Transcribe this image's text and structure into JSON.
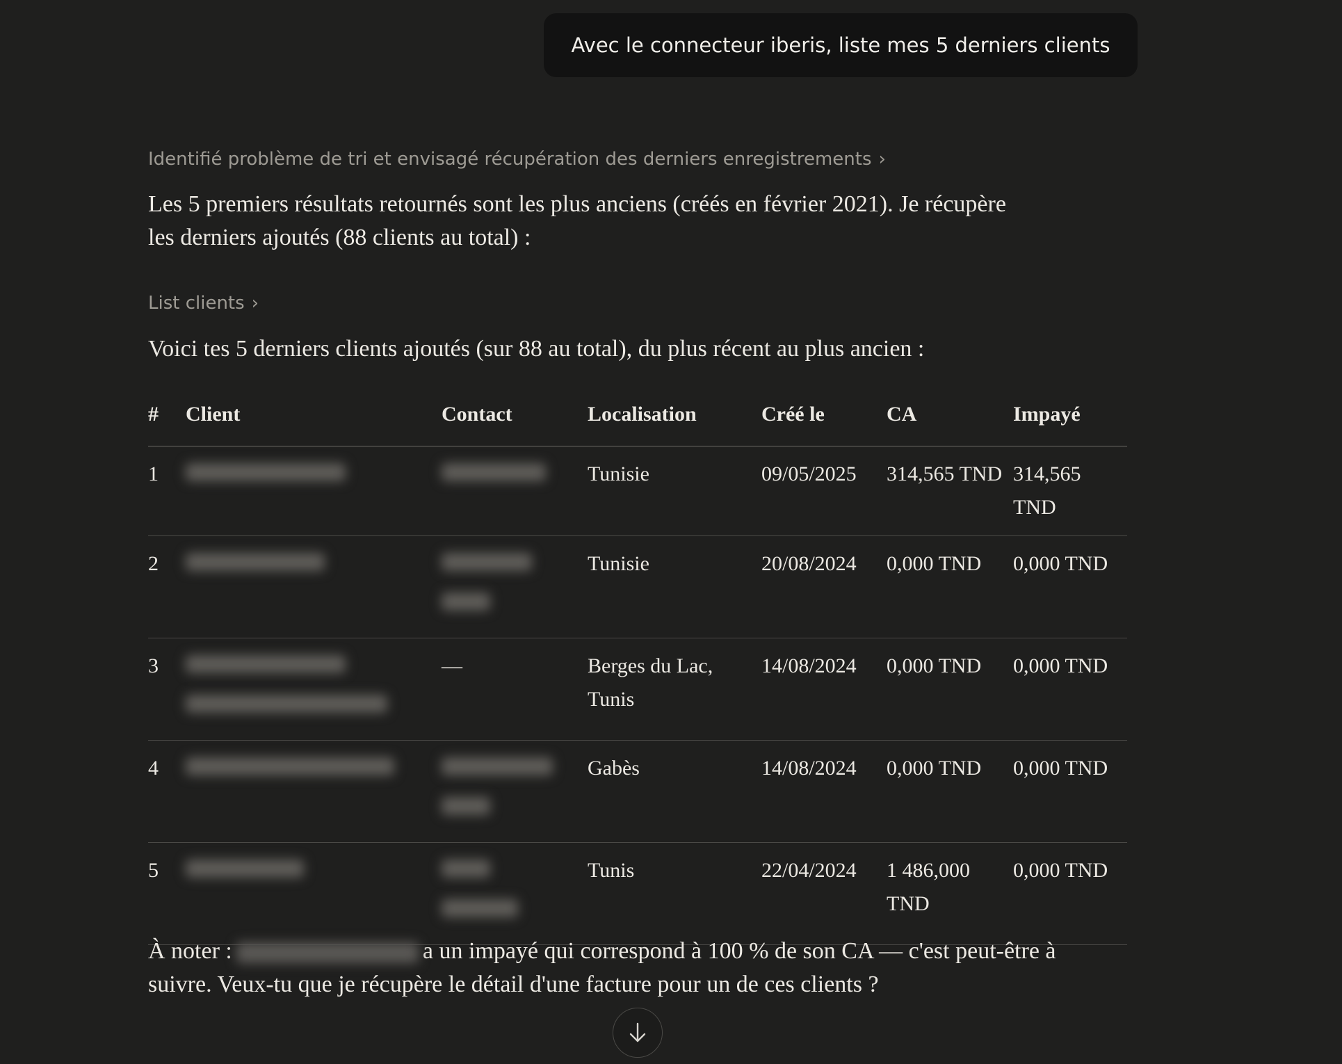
{
  "user_message": "Avec le connecteur iberis, liste mes 5 derniers clients",
  "thinking_label": "Identifié problème de tri et envisagé récupération des derniers enregistrements",
  "paragraph1_line1": "Les 5 premiers résultats retournés sont les plus anciens (créés en février 2021). Je récupère",
  "paragraph1_line2": "les derniers ajoutés (88 clients au total) :",
  "tool_label": "List clients",
  "intro": "Voici tes 5 derniers clients ajoutés (sur 88 au total), du plus récent au plus ancien :",
  "table": {
    "headers": [
      "#",
      "Client",
      "Contact",
      "Localisation",
      "Créé le",
      "CA",
      "Impayé"
    ],
    "rows": [
      {
        "num": "1",
        "contact": "",
        "location": "Tunisie",
        "created": "09/05/2025",
        "ca": "314,565 TND",
        "unpaid": "314,565 TND"
      },
      {
        "num": "2",
        "contact": "",
        "location": "Tunisie",
        "created": "20/08/2024",
        "ca": "0,000 TND",
        "unpaid": "0,000 TND"
      },
      {
        "num": "3",
        "contact": "—",
        "location": "Berges du Lac, Tunis",
        "created": "14/08/2024",
        "ca": "0,000 TND",
        "unpaid": "0,000 TND"
      },
      {
        "num": "4",
        "contact": "",
        "location": "Gabès",
        "created": "14/08/2024",
        "ca": "0,000 TND",
        "unpaid": "0,000 TND"
      },
      {
        "num": "5",
        "contact": "",
        "location": "Tunis",
        "created": "22/04/2024",
        "ca": "1 486,000 TND",
        "unpaid": "0,000 TND"
      }
    ]
  },
  "note_prefix": "À noter :",
  "note_suffix": "a un impayé qui correspond à 100 % de son CA — c'est peut-être à",
  "note_line2": "suivre. Veux-tu que je récupère le détail d'une facture pour un de ces clients ?",
  "icons": {
    "chevron": "chevron-right-icon",
    "scroll": "arrow-down-icon"
  }
}
